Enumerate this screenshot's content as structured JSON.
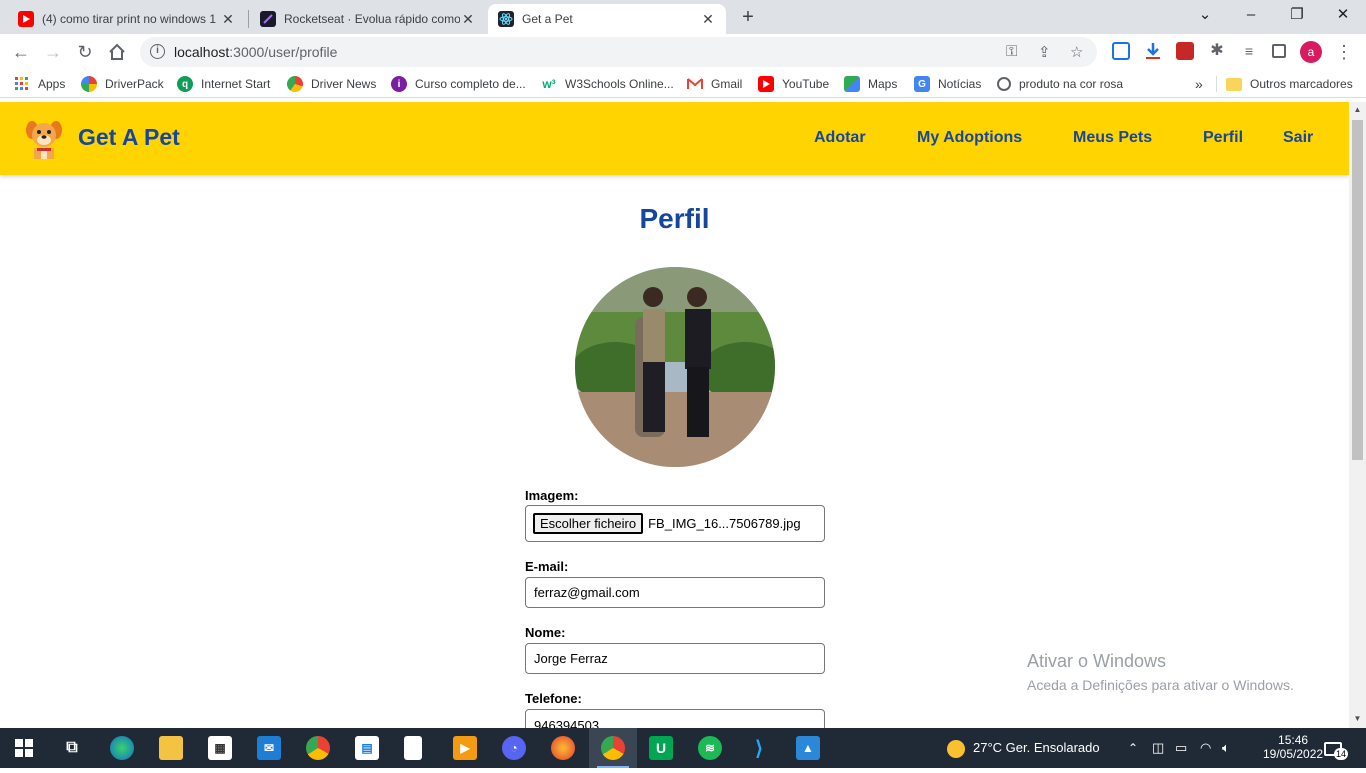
{
  "browser": {
    "tabs": [
      {
        "title": "(4) como tirar print no windows 1",
        "icon": "youtube-icon"
      },
      {
        "title": "Rocketseat · Evolua rápido como",
        "icon": "rocketseat-icon"
      },
      {
        "title": "Get a Pet",
        "icon": "react-icon"
      }
    ],
    "url_host": "localhost",
    "url_rest": ":3000/user/profile",
    "profile_initial": "a",
    "bookmarks": [
      "Apps",
      "DriverPack",
      "Internet Start",
      "Driver News",
      "Curso completo de...",
      "W3Schools Online...",
      "Gmail",
      "YouTube",
      "Maps",
      "Notícias",
      "produto na cor rosa"
    ],
    "other_bookmarks": "Outros marcadores"
  },
  "app": {
    "brand": "Get A Pet",
    "nav": [
      "Adotar",
      "My Adoptions",
      "Meus Pets",
      "Perfil",
      "Sair"
    ],
    "page_title": "Perfil",
    "form": {
      "image_label": "Imagem:",
      "file_button": "Escolher ficheiro",
      "file_name": "FB_IMG_16...7506789.jpg",
      "email_label": "E-mail:",
      "email_value": "ferraz@gmail.com",
      "name_label": "Nome:",
      "name_value": "Jorge Ferraz",
      "phone_label": "Telefone:",
      "phone_value": "946394503"
    },
    "accent": "#FFD400",
    "brand_color": "#16479D"
  },
  "watermark": {
    "line1": "Ativar o Windows",
    "line2": "Aceda a Definições para ativar o Windows."
  },
  "taskbar": {
    "weather": "27°C  Ger. Ensolarado",
    "time": "15:46",
    "date": "19/05/2022",
    "notifications": "14"
  }
}
